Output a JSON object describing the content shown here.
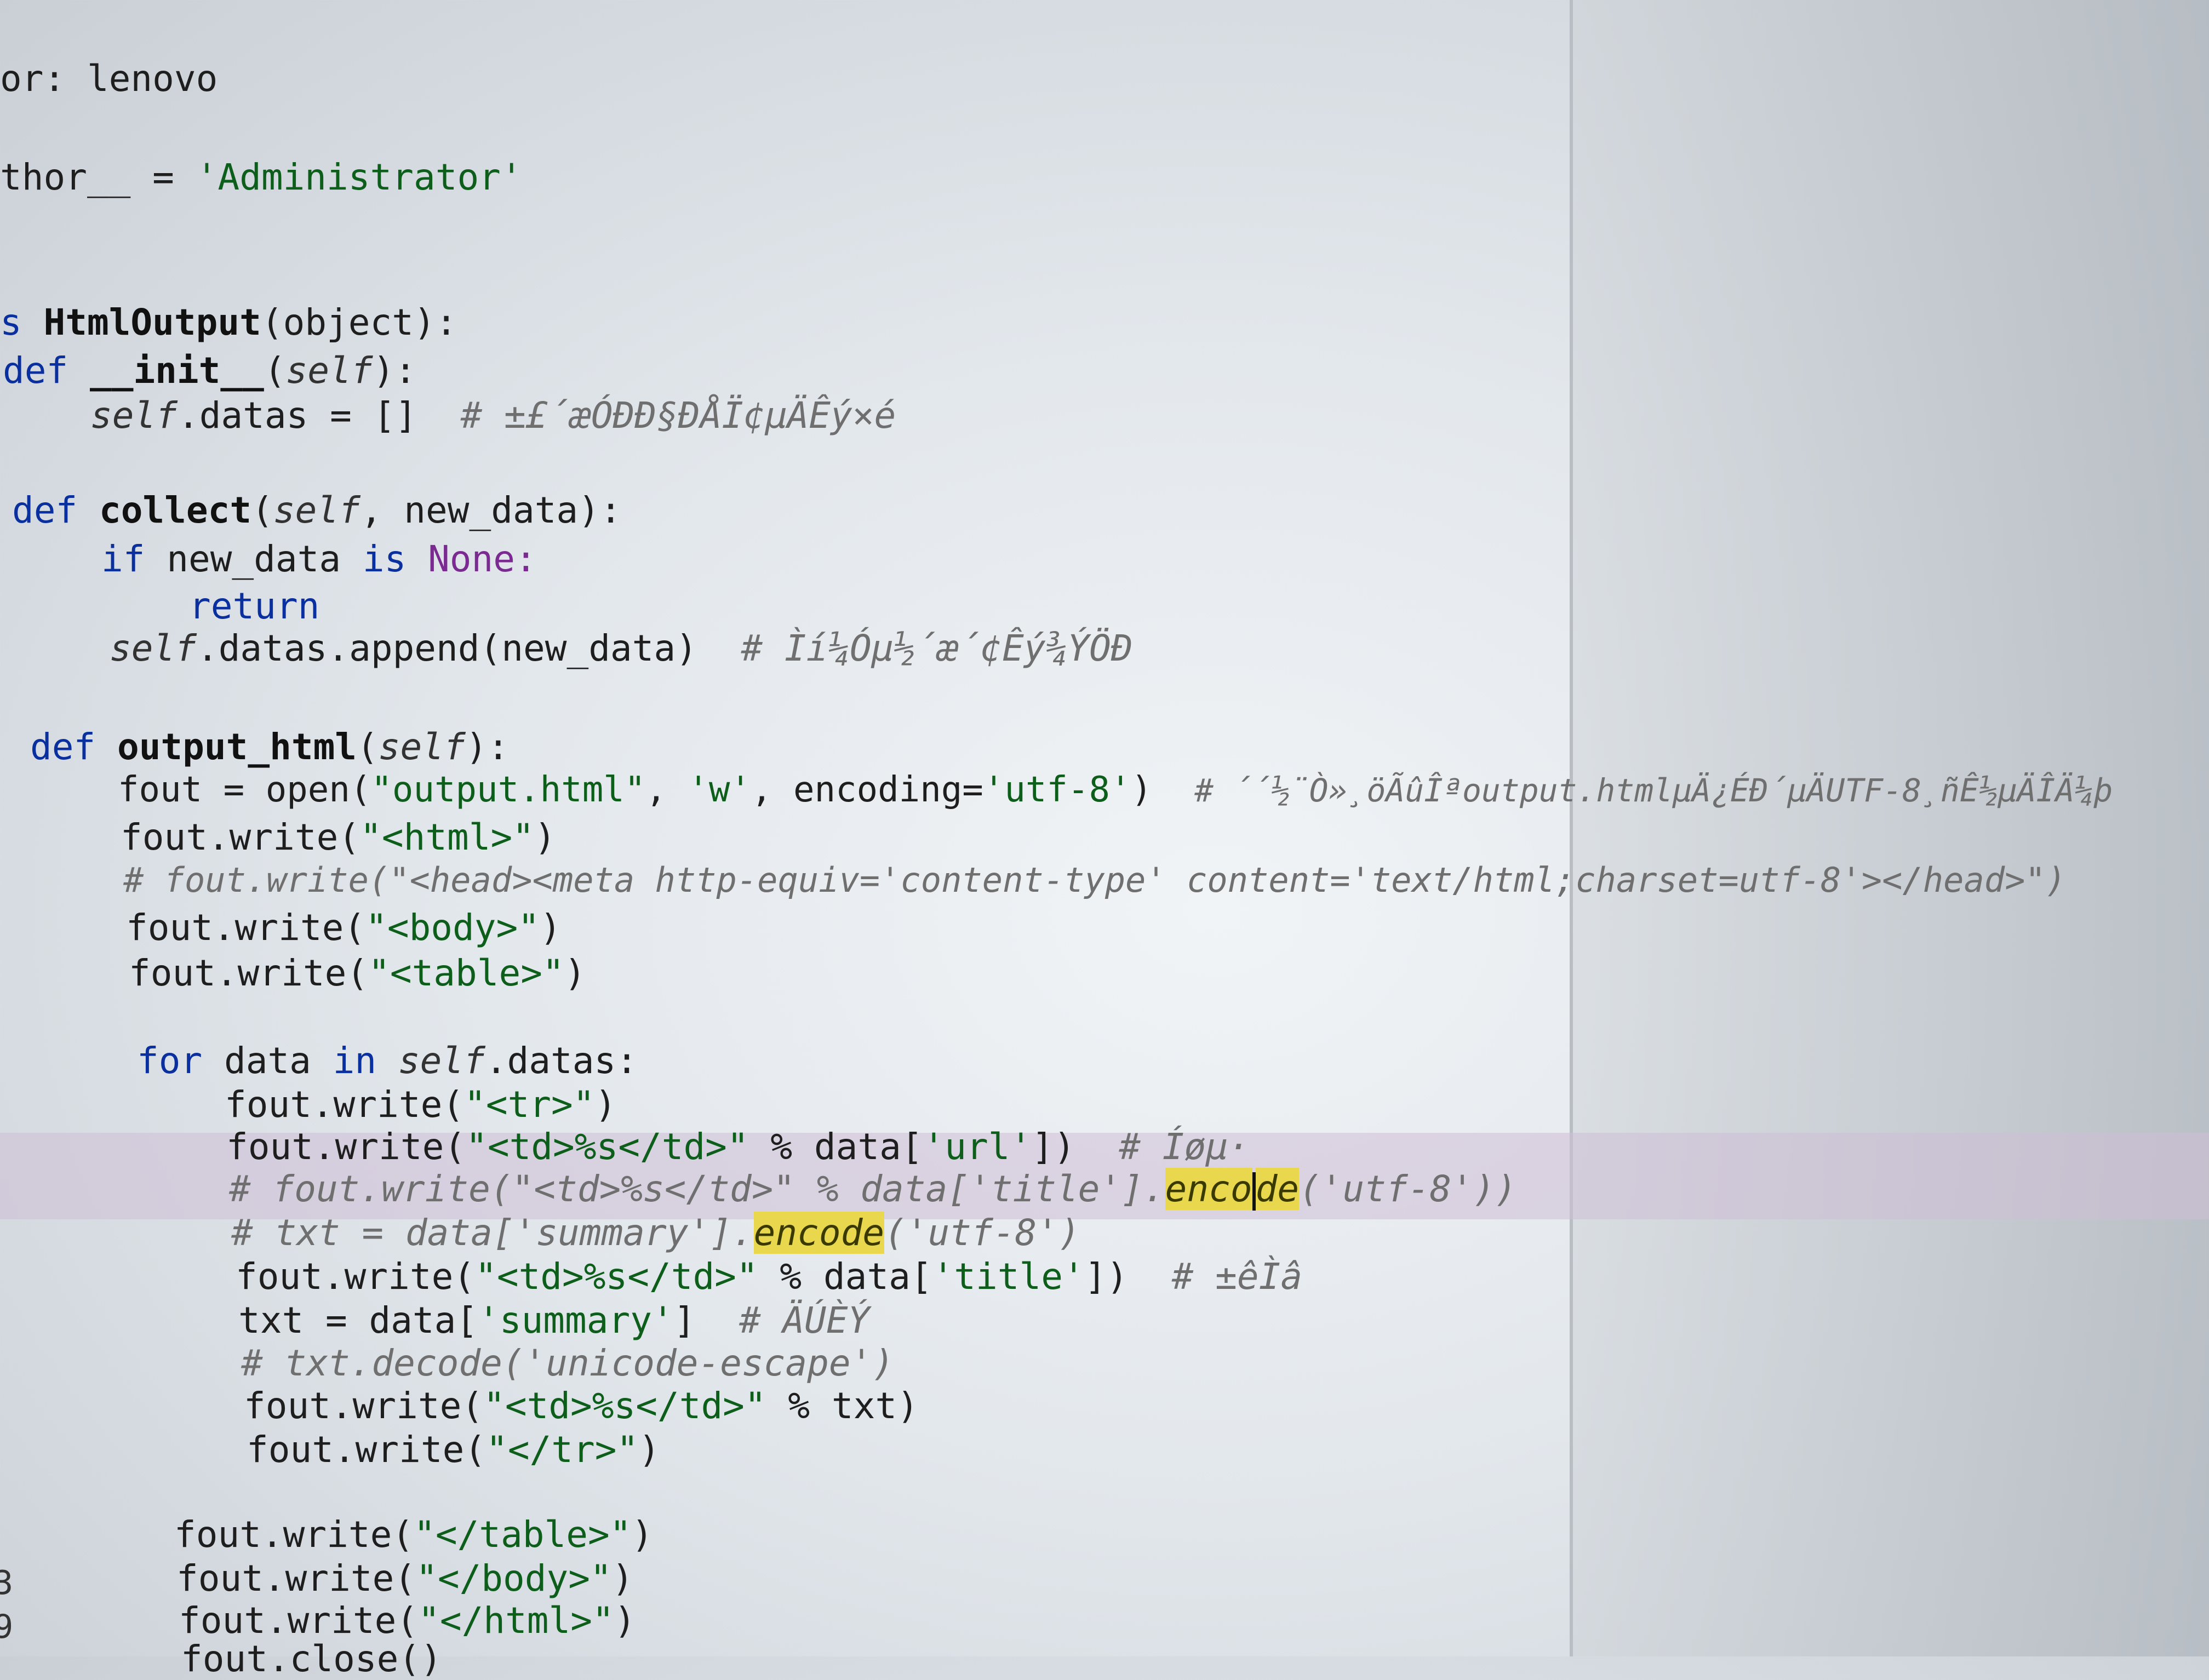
{
  "code": {
    "l1": "or: lenovo",
    "l2a": "thor__ = ",
    "l2b": "'Administrator'",
    "l3a": "s ",
    "l3b": "HtmlOutput",
    "l3c": "(object):",
    "l4a": "def ",
    "l4b": "__init__",
    "l4c": "(",
    "l4d": "self",
    "l4e": "):",
    "l5a": "self",
    "l5b": ".datas = []  ",
    "l5c": "# ±£´æÓÐÐ§ÐÅÏ¢µÄÊý×é",
    "l6a": "def ",
    "l6b": "collect",
    "l6c": "(",
    "l6d": "self",
    "l6e": ", new_data):",
    "l7a": "if ",
    "l7b": "new_data ",
    "l7c": "is ",
    "l7d": "None:",
    "l8": "return",
    "l9a": "self",
    "l9b": ".datas.append(new_data)  ",
    "l9c": "# Ìí¼Óµ½´æ´¢Êý¾ÝÖÐ",
    "l10a": "def ",
    "l10b": "output_html",
    "l10c": "(",
    "l10d": "self",
    "l10e": "):",
    "l11a": "fout = open(",
    "l11b": "\"output.html\"",
    "l11c": ", ",
    "l11d": "'w'",
    "l11e": ", encoding=",
    "l11f": "'utf-8'",
    "l11g": ")  ",
    "l11h": "# ´´½¨Ò»¸öÃûÎªoutput.htmlµÄ¿ÉÐ´µÄUTF-8¸ñÊ½µÄÎÄ¼þ",
    "l12a": "fout.write(",
    "l12b": "\"<html>\"",
    "l12c": ")",
    "l13": "# fout.write(\"<head><meta http-equiv='content-type' content='text/html;charset=utf-8'></head>\")",
    "l14a": "fout.write(",
    "l14b": "\"<body>\"",
    "l14c": ")",
    "l15a": "fout.write(",
    "l15b": "\"<table>\"",
    "l15c": ")",
    "l16a": "for ",
    "l16b": "data ",
    "l16c": "in ",
    "l16d": "self",
    "l16e": ".datas:",
    "l17a": "fout.write(",
    "l17b": "\"<tr>\"",
    "l17c": ")",
    "l18a": "fout.write(",
    "l18b": "\"<td>%s</td>\"",
    "l18c": " % data[",
    "l18d": "'url'",
    "l18e": "])  ",
    "l18f": "# Íøµ·",
    "l19a": "# fout.write(\"<td>%s</td>\" % data['title'].",
    "l19b": "enco",
    "l19c": "de",
    "l19d": "('utf-8'))",
    "l20a": "# txt = data['summary'].",
    "l20b": "encode",
    "l20c": "('utf-8')",
    "l21a": "fout.write(",
    "l21b": "\"<td>%s</td>\"",
    "l21c": " % data[",
    "l21d": "'title'",
    "l21e": "])  ",
    "l21f": "# ±êÌâ",
    "l22a": "txt = data[",
    "l22b": "'summary'",
    "l22c": "]  ",
    "l22d": "# ÄÚÈÝ",
    "l23": "# txt.decode('unicode-escape')",
    "l24a": "fout.write(",
    "l24b": "\"<td>%s</td>\"",
    "l24c": " % txt)",
    "l25a": "fout.write(",
    "l25b": "\"</tr>\"",
    "l25c": ")",
    "l26a": "fout.write(",
    "l26b": "\"</table>\"",
    "l26c": ")",
    "l27a": "fout.write(",
    "l27b": "\"</body>\"",
    "l27c": ")",
    "l28a": "fout.write(",
    "l28b": "\"</html>\"",
    "l28c": ")",
    "l29": "fout.close()"
  },
  "gutter": {
    "n1": "3",
    "n2": "9"
  }
}
